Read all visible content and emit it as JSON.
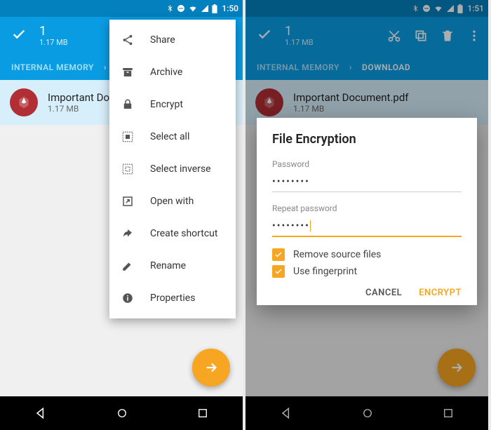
{
  "screen1": {
    "status": {
      "time": "1:50"
    },
    "actionbar": {
      "count": "1",
      "size": "1.17 MB"
    },
    "breadcrumb": {
      "first": "INTERNAL MEMORY",
      "last": ""
    },
    "file": {
      "name": "Important Docum…",
      "size": "1.17 MB"
    },
    "menu": {
      "items": [
        {
          "label": "Share",
          "icon": "share-icon"
        },
        {
          "label": "Archive",
          "icon": "archive-icon"
        },
        {
          "label": "Encrypt",
          "icon": "lock-icon"
        },
        {
          "label": "Select all",
          "icon": "select-all-icon"
        },
        {
          "label": "Select inverse",
          "icon": "select-inverse-icon"
        },
        {
          "label": "Open with",
          "icon": "open-with-icon"
        },
        {
          "label": "Create shortcut",
          "icon": "shortcut-icon"
        },
        {
          "label": "Rename",
          "icon": "rename-icon"
        },
        {
          "label": "Properties",
          "icon": "info-icon"
        }
      ]
    }
  },
  "screen2": {
    "status": {
      "time": "1:51"
    },
    "actionbar": {
      "count": "1",
      "size": "1.17 MB"
    },
    "breadcrumb": {
      "first": "INTERNAL MEMORY",
      "last": "DOWNLOAD"
    },
    "file": {
      "name": "Important Document.pdf",
      "size": "1.17 MB"
    },
    "dialog": {
      "title": "File Encryption",
      "password_label": "Password",
      "password_value": "••••••••",
      "repeat_label": "Repeat password",
      "repeat_value": "••••••••",
      "remove_source": "Remove source files",
      "use_fingerprint": "Use fingerprint",
      "cancel": "CANCEL",
      "encrypt": "ENCRYPT"
    }
  }
}
